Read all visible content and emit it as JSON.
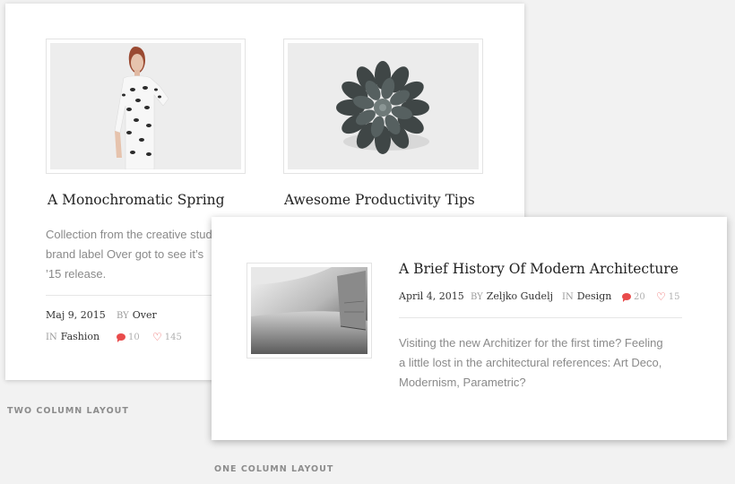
{
  "two_column": {
    "caption": "TWO COLUMN LAYOUT",
    "posts": [
      {
        "image": "fashion-model-photo",
        "title": "A Monochromatic Spring",
        "excerpt_lines": [
          "Collection from the creative studio",
          "brand label Over got to see it’s",
          "’15 release."
        ],
        "date": "Maj 9, 2015",
        "by_label": "BY",
        "author": "Over",
        "in_label": "IN",
        "category": "Fashion",
        "comments": "10",
        "likes": "145"
      },
      {
        "image": "succulent-plant-photo",
        "title": "Awesome Productivity Tips"
      }
    ]
  },
  "one_column": {
    "caption": "ONE COLUMN LAYOUT",
    "post": {
      "image": "architecture-photo",
      "title": "A Brief History Of Modern Architecture",
      "date": "April 4, 2015",
      "by_label": "BY",
      "author": "Zeljko Gudelj",
      "in_label": "IN",
      "category": "Design",
      "comments": "20",
      "likes": "15",
      "excerpt_lines": [
        "Visiting the new Architizer for the first time? Feeling",
        "a little lost in the architectural references: Art Deco,",
        "Modernism, Parametric?"
      ]
    }
  },
  "colors": {
    "accent": "#e94b4b",
    "muted_text": "#8a8a8a",
    "background": "#f2f2f2"
  }
}
